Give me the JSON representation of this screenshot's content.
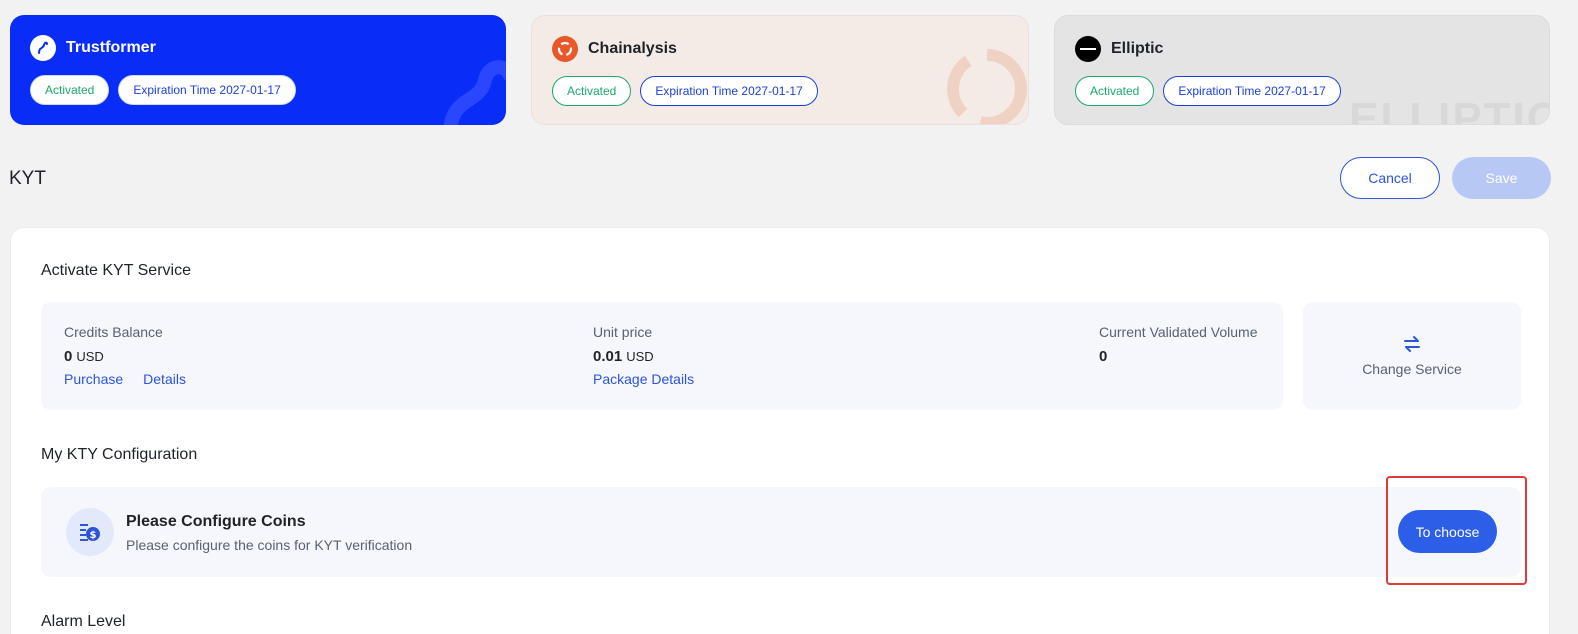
{
  "providers": [
    {
      "name": "Trustformer",
      "status": "Activated",
      "expiration": "Expiration Time 2027-01-17"
    },
    {
      "name": "Chainalysis",
      "status": "Activated",
      "expiration": "Expiration Time 2027-01-17"
    },
    {
      "name": "Elliptic",
      "status": "Activated",
      "expiration": "Expiration Time 2027-01-17",
      "watermark": "ELLIPTIC"
    }
  ],
  "page": {
    "title": "KYT",
    "cancel_label": "Cancel",
    "save_label": "Save"
  },
  "activate": {
    "title": "Activate KYT Service",
    "credits": {
      "label": "Credits Balance",
      "value": "0",
      "unit": "USD",
      "purchase": "Purchase",
      "details": "Details"
    },
    "unit_price": {
      "label": "Unit price",
      "value": "0.01",
      "unit": "USD",
      "link": "Package Details"
    },
    "volume": {
      "label": "Current Validated Volume",
      "value": "0"
    },
    "change_service": "Change Service"
  },
  "config": {
    "title": "My KTY Configuration",
    "card_title": "Please Configure Coins",
    "card_desc": "Please configure the coins for KYT verification",
    "button": "To choose"
  },
  "alarm": {
    "title": "Alarm Level"
  },
  "colors": {
    "trustformer_blue": "#0a2cf7",
    "primary": "#2c55d8",
    "activated_green": "#1aa96b",
    "highlight_red": "#e03a3a"
  }
}
